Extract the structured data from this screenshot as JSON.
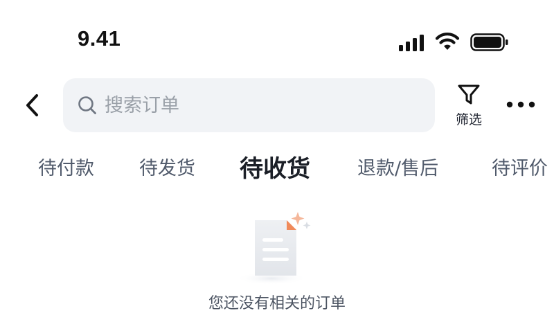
{
  "status_bar": {
    "time": "9.41",
    "icons": [
      "cellular-signal-icon",
      "wifi-icon",
      "battery-icon"
    ]
  },
  "header": {
    "back_icon": "chevron-left-icon",
    "search": {
      "placeholder": "搜索订单",
      "value": "",
      "icon": "search-icon"
    },
    "filter": {
      "label": "筛选",
      "icon": "funnel-filter-icon"
    },
    "more_icon": "more-dots-icon"
  },
  "tabs": [
    {
      "label": "待付款",
      "active": false
    },
    {
      "label": "待发货",
      "active": false
    },
    {
      "label": "待收货",
      "active": true
    },
    {
      "label": "退款/售后",
      "active": false
    },
    {
      "label": "待评价",
      "active": false
    }
  ],
  "empty_state": {
    "illustration": "empty-document-icon",
    "message": "您还没有相关的订单"
  },
  "colors": {
    "search_background": "#f1f3f6",
    "placeholder": "#9aa0a8",
    "tab_inactive": "#505a6b",
    "tab_active": "#1b1f27",
    "accent_corner": "#f08a5a"
  }
}
